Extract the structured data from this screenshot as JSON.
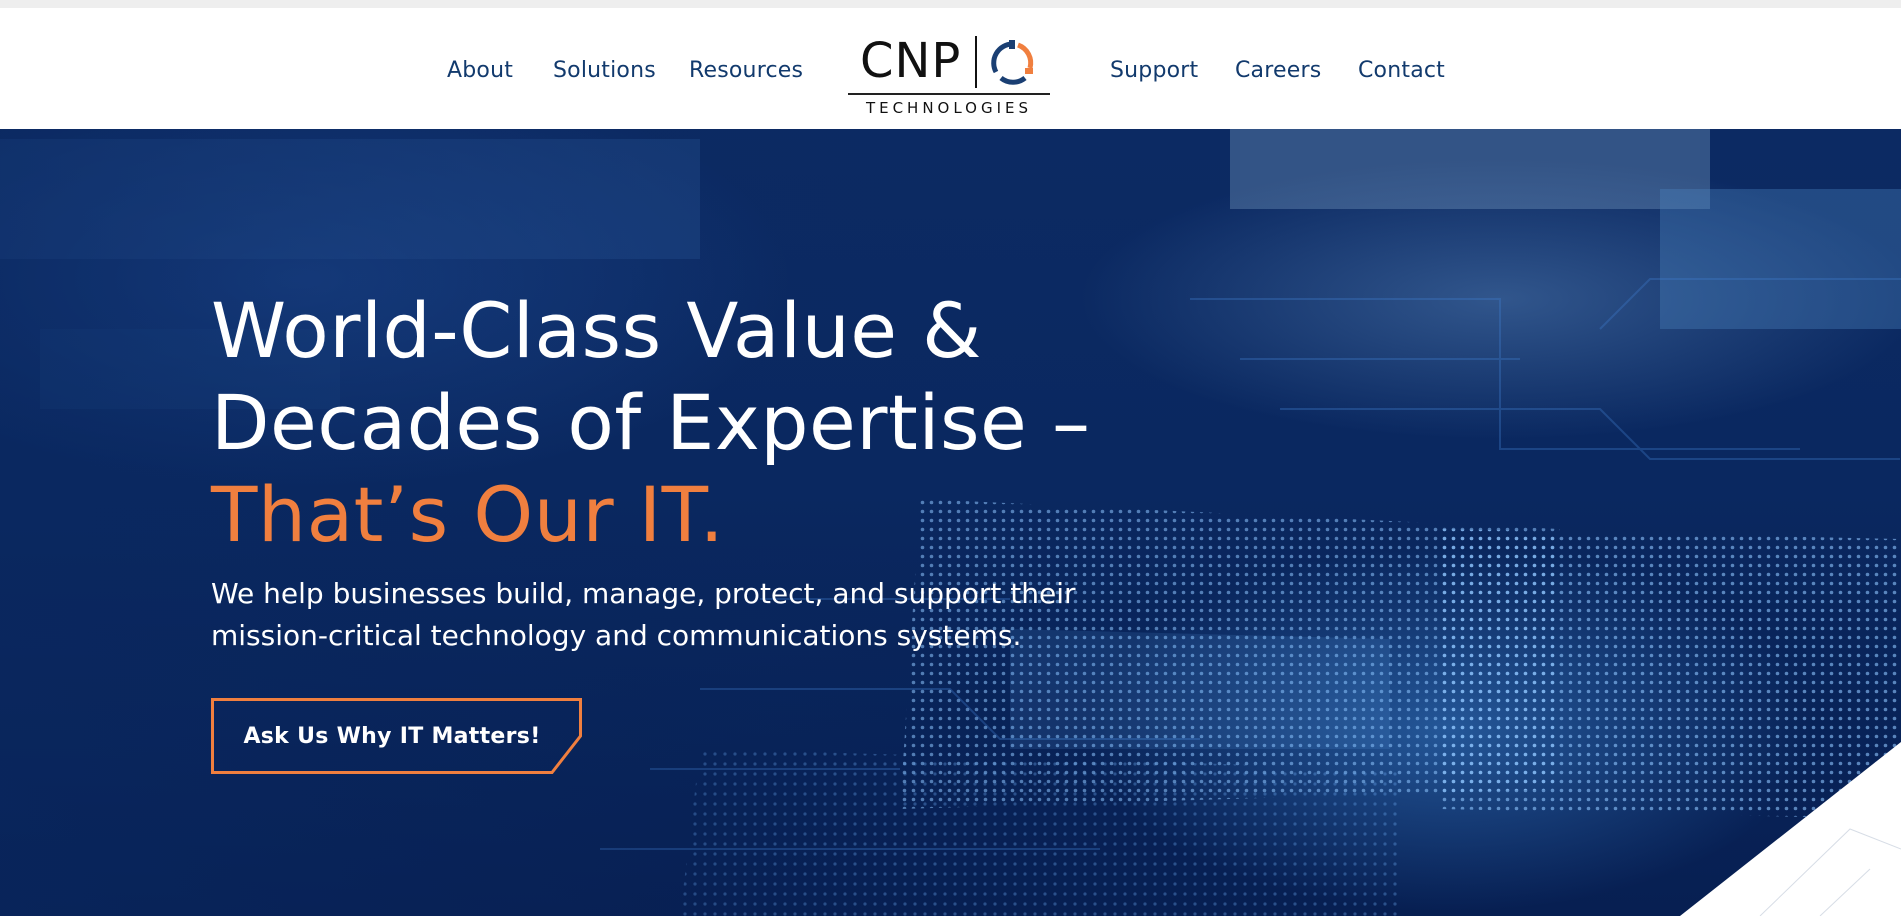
{
  "nav": {
    "left": [
      "About",
      "Solutions",
      "Resources"
    ],
    "right": [
      "Support",
      "Careers",
      "Contact"
    ]
  },
  "logo": {
    "wordmark": "CNP",
    "subtitle": "TECHNOLOGIES",
    "icon": "cnp-ring-logo-icon"
  },
  "hero": {
    "headline_line1": "World-Class Value &",
    "headline_line2": "Decades of Expertise –",
    "headline_accent": "That’s Our IT.",
    "subtext": "We help businesses build, manage, protect, and support their mission-critical technology and communications systems.",
    "cta_label": "Ask Us Why IT Matters!"
  },
  "colors": {
    "nav_text": "#123a6d",
    "accent": "#f07f3f",
    "hero_bg": "#0a2860",
    "header_bg": "#ffffff"
  }
}
